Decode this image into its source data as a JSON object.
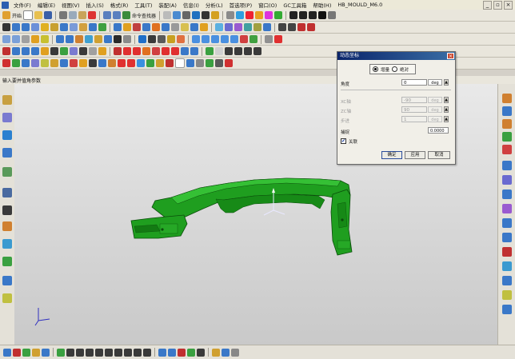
{
  "menu": {
    "app_icon": "nx-app-icon",
    "items": [
      "文件(F)",
      "编辑(E)",
      "视图(V)",
      "插入(S)",
      "格式(R)",
      "工具(T)",
      "装配(A)",
      "信息(I)",
      "分析(L)",
      "首选项(P)",
      "窗口(O)",
      "GC工具箱",
      "帮助(H)",
      "HB_MOULD_M6.0"
    ]
  },
  "toolbar1": {
    "start_label": "开始",
    "command_finder_label": "命令查找器"
  },
  "cue_line": {
    "text": "输入要并值角参数"
  },
  "dialog": {
    "title": "动态坐标",
    "radio": {
      "option1": "增量",
      "option2": "绝对"
    },
    "angle_label": "角度",
    "angle_value": "0",
    "angle_unit": "deg",
    "dim_fields": [
      {
        "label": "XC轴",
        "value": "-90",
        "unit": "deg"
      },
      {
        "label": "ZC轴",
        "value": "90",
        "unit": "deg"
      },
      {
        "label": "步进",
        "value": "1",
        "unit": "deg"
      }
    ],
    "snap_label": "捕捉",
    "snap_value": "0.0000",
    "checkbox_label": "关联",
    "buttons": {
      "ok": "确定",
      "apply": "应用",
      "cancel": "取消"
    }
  },
  "colors": {
    "model_green": "#1f9e1f",
    "dialog_title": "#0a246a",
    "highlight_yellow": "#fff000"
  }
}
